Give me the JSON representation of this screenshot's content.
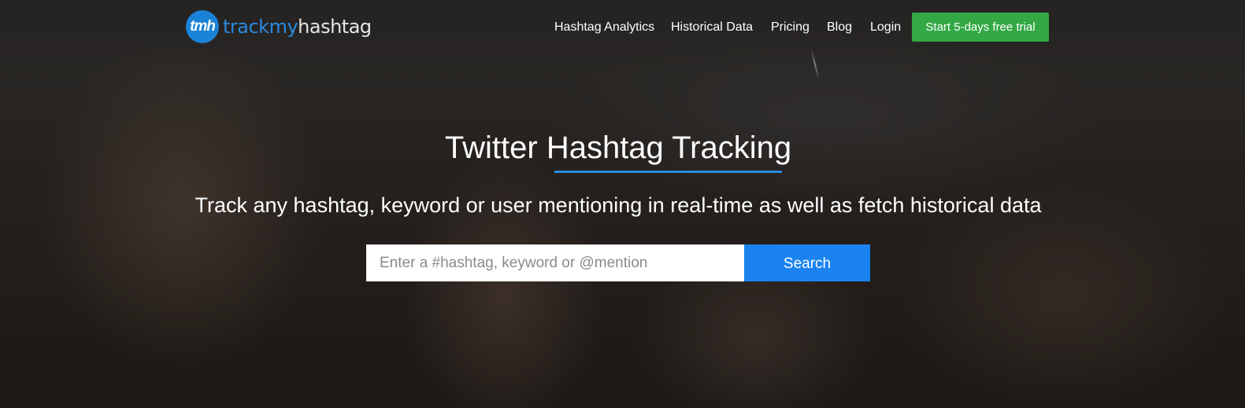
{
  "header": {
    "logo": {
      "badge": "tmh",
      "text_part1": "trackmy",
      "text_part2": "hashtag"
    },
    "nav": [
      {
        "label": "Hashtag Analytics"
      },
      {
        "label": "Historical Data"
      },
      {
        "label": "Pricing"
      },
      {
        "label": "Blog"
      },
      {
        "label": "Login"
      }
    ],
    "cta_label": "Start 5-days free trial"
  },
  "hero": {
    "title": "Twitter Hashtag Tracking",
    "subtitle": "Track any hashtag, keyword or user mentioning in real-time as well as fetch historical data",
    "search": {
      "placeholder": "Enter a #hashtag, keyword or @mention",
      "value": "",
      "button_label": "Search"
    }
  },
  "colors": {
    "brand_blue": "#2a8ae0",
    "cta_green": "#33a845",
    "search_button": "#1a83f0"
  }
}
